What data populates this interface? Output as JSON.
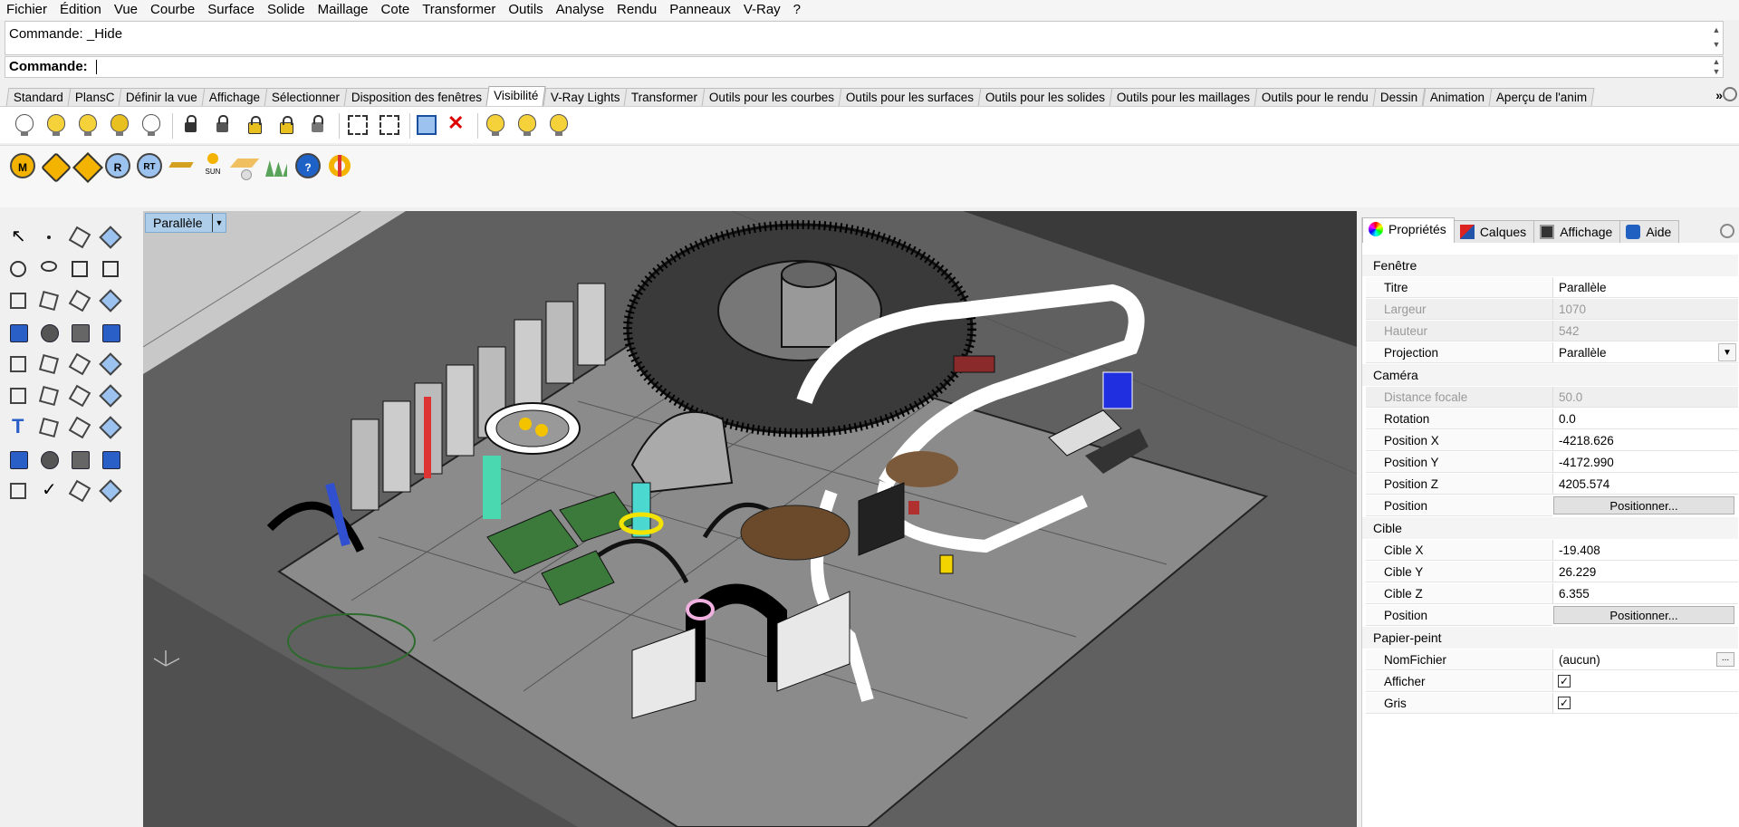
{
  "menu": [
    "Fichier",
    "Édition",
    "Vue",
    "Courbe",
    "Surface",
    "Solide",
    "Maillage",
    "Cote",
    "Transformer",
    "Outils",
    "Analyse",
    "Rendu",
    "Panneaux",
    "V-Ray",
    "?"
  ],
  "command": {
    "history": "Commande: _Hide",
    "prompt_label": "Commande:"
  },
  "toolbar_tabs": [
    "Standard",
    "PlansC",
    "Définir la vue",
    "Affichage",
    "Sélectionner",
    "Disposition des fenêtres",
    "Visibilité",
    "V-Ray Lights",
    "Transformer",
    "Outils pour les courbes",
    "Outils pour les surfaces",
    "Outils pour les solides",
    "Outils pour les maillages",
    "Outils pour le rendu",
    "Dessin",
    "Animation",
    "Aperçu de l'anim"
  ],
  "active_tab": "Visibilité",
  "vray_toolbar": {
    "sun_label": "SUN",
    "m_label": "M",
    "r_label": "R",
    "rt_label": "RT",
    "help_label": "?"
  },
  "viewport": {
    "label": "Parallèle"
  },
  "panel": {
    "tabs": [
      "Propriétés",
      "Calques",
      "Affichage",
      "Aide"
    ],
    "sections": {
      "fenetre": "Fenêtre",
      "camera": "Caméra",
      "cible": "Cible",
      "papier": "Papier-peint"
    },
    "fenetre": [
      {
        "k": "Titre",
        "v": "Parallèle"
      },
      {
        "k": "Largeur",
        "v": "1070"
      },
      {
        "k": "Hauteur",
        "v": "542"
      },
      {
        "k": "Projection",
        "v": "Parallèle"
      }
    ],
    "camera": [
      {
        "k": "Distance focale",
        "v": "50.0"
      },
      {
        "k": "Rotation",
        "v": "0.0"
      },
      {
        "k": "Position X",
        "v": "-4218.626"
      },
      {
        "k": "Position Y",
        "v": "-4172.990"
      },
      {
        "k": "Position Z",
        "v": "4205.574"
      },
      {
        "k": "Position",
        "v": "Positionner..."
      }
    ],
    "cible": [
      {
        "k": "Cible X",
        "v": "-19.408"
      },
      {
        "k": "Cible Y",
        "v": "26.229"
      },
      {
        "k": "Cible Z",
        "v": "6.355"
      },
      {
        "k": "Position",
        "v": "Positionner..."
      }
    ],
    "papier": [
      {
        "k": "NomFichier",
        "v": "(aucun)"
      },
      {
        "k": "Afficher",
        "v": "✓"
      },
      {
        "k": "Gris",
        "v": "✓"
      }
    ],
    "ellipsis": "..."
  },
  "colors": {
    "viewport_bg": "#606060",
    "floor": "#8a8a8a",
    "label_bg": "#aecde8"
  }
}
